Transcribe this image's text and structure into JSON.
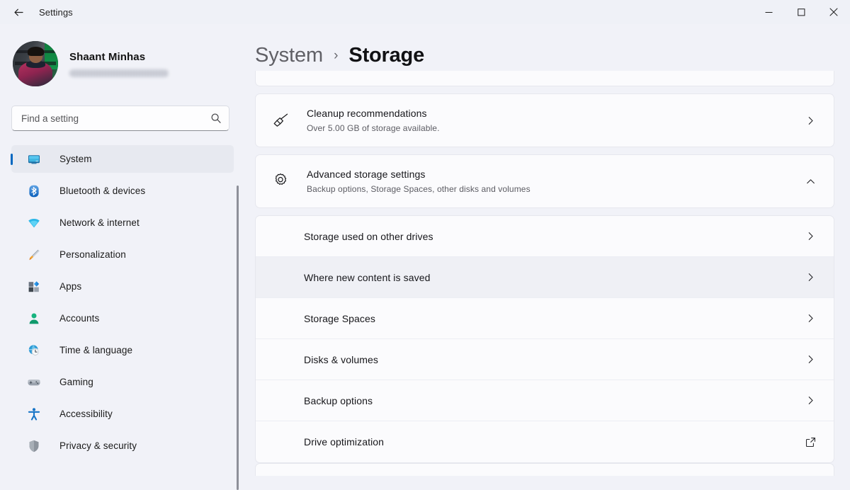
{
  "titlebar": {
    "back_icon": "back-arrow-icon",
    "app_title": "Settings",
    "minimize_label": "–",
    "maximize_label": "□",
    "close_label": "✕"
  },
  "account": {
    "name": "Shaant Minhas",
    "email_redacted": true,
    "avatar_alt": "user-avatar-photo"
  },
  "search": {
    "placeholder": "Find a setting",
    "value": "",
    "icon": "search-icon"
  },
  "sidebar": {
    "items": [
      {
        "label": "System",
        "icon": "monitor-icon",
        "active": true
      },
      {
        "label": "Bluetooth & devices",
        "icon": "bluetooth-icon",
        "active": false
      },
      {
        "label": "Network & internet",
        "icon": "wifi-icon",
        "active": false
      },
      {
        "label": "Personalization",
        "icon": "paintbrush-icon",
        "active": false
      },
      {
        "label": "Apps",
        "icon": "apps-icon",
        "active": false
      },
      {
        "label": "Accounts",
        "icon": "person-icon",
        "active": false
      },
      {
        "label": "Time & language",
        "icon": "globe-clock-icon",
        "active": false
      },
      {
        "label": "Gaming",
        "icon": "gamepad-icon",
        "active": false
      },
      {
        "label": "Accessibility",
        "icon": "accessibility-icon",
        "active": false
      },
      {
        "label": "Privacy & security",
        "icon": "shield-icon",
        "active": false
      }
    ]
  },
  "breadcrumb": {
    "parent": "System",
    "separator": "›",
    "current": "Storage"
  },
  "main": {
    "cards": [
      {
        "type": "partial-top",
        "title": "",
        "subtitle": ""
      },
      {
        "type": "row",
        "icon": "broom-icon",
        "title": "Cleanup recommendations",
        "subtitle": "Over 5.00 GB of storage available.",
        "trailing_icon": "chevron-right-icon"
      },
      {
        "type": "expandable",
        "icon": "gear-icon",
        "title": "Advanced storage settings",
        "subtitle": "Backup options, Storage Spaces, other disks and volumes",
        "trailing_icon": "chevron-up-icon",
        "expanded": true,
        "children": [
          {
            "title": "Storage used on other drives",
            "trailing_icon": "chevron-right-icon",
            "hovered": false
          },
          {
            "title": "Where new content is saved",
            "trailing_icon": "chevron-right-icon",
            "hovered": true
          },
          {
            "title": "Storage Spaces",
            "trailing_icon": "chevron-right-icon",
            "hovered": false
          },
          {
            "title": "Disks & volumes",
            "trailing_icon": "chevron-right-icon",
            "hovered": false
          },
          {
            "title": "Backup options",
            "trailing_icon": "chevron-right-icon",
            "hovered": false
          },
          {
            "title": "Drive optimization",
            "trailing_icon": "external-link-icon",
            "hovered": false
          }
        ]
      },
      {
        "type": "partial-bottom"
      }
    ]
  },
  "colors": {
    "accent": "#0067c0",
    "window_bg": "#f1f2f8",
    "card_bg": "#fbfbfd",
    "card_border": "#e6e7ee",
    "text_primary": "#16161a",
    "text_secondary": "#5c5c63",
    "hover_row": "#eff0f5"
  }
}
